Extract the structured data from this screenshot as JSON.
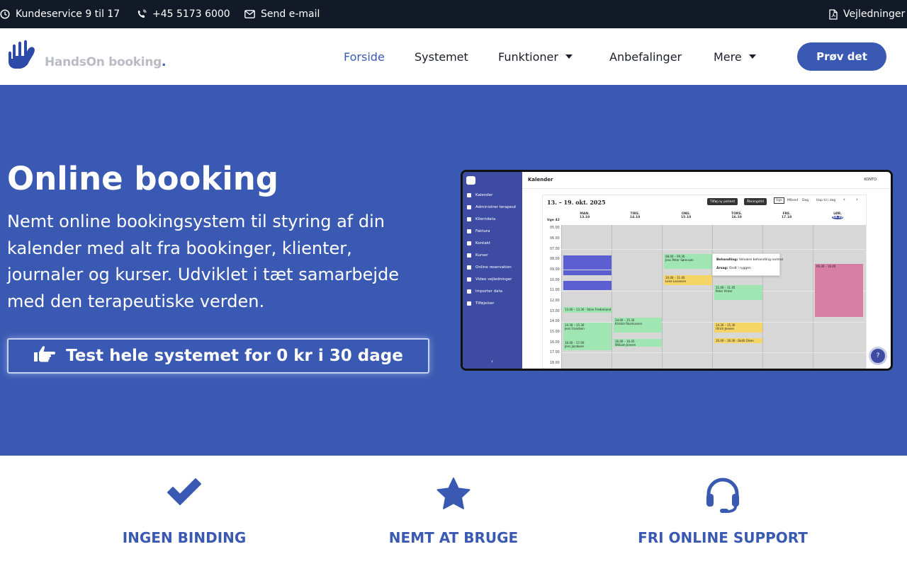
{
  "topbar": {
    "hours": "Kundeservice 9 til 17",
    "phone": "+45 5173 6000",
    "email": "Send e-mail",
    "guides": "Vejledninger"
  },
  "brand": {
    "name": "HandsOn booking",
    "dot": "."
  },
  "nav": {
    "items": [
      {
        "label": "Forside",
        "active": true
      },
      {
        "label": "Systemet"
      },
      {
        "label": "Funktioner",
        "dropdown": true
      },
      {
        "label": "Anbefalinger"
      },
      {
        "label": "Mere",
        "dropdown": true
      }
    ],
    "cta": "Prøv det"
  },
  "hero": {
    "title": "Online booking",
    "subtitle": "Nemt online bookingsystem til styring af din kalender med alt fra bookinger, klienter, journaler og kurser. Udviklet i tæt samarbejde med den terapeutiske verden.",
    "button": "Test hele systemet for 0 kr i 30 dage"
  },
  "mockup": {
    "sidebar": [
      "Kalender",
      "Administrer terapeut",
      "Klientdata",
      "Faktura",
      "Kontakt",
      "Kurser",
      "Online reservation",
      "Video vejledninger",
      "Importer data",
      "Tilføjelser"
    ],
    "title": "Kalender",
    "account": "KONTO",
    "date_range": "13. – 19. okt. 2025",
    "buttons": [
      "Tilføj ny patient",
      "Åbningstid"
    ],
    "views": [
      "Uge",
      "Måned",
      "Dag",
      "Hop til i dag"
    ],
    "week_label": "Uge 42",
    "days": [
      "MAN.",
      "TIRS.",
      "ONS.",
      "TORS.",
      "FRE.",
      "LØR."
    ],
    "dates": [
      "13.10",
      "14.10",
      "15.10",
      "16.10",
      "17.10",
      "18.10"
    ],
    "hours": [
      "05.00",
      "06.00",
      "07.00",
      "08.00",
      "09.00",
      "10.00",
      "11.00",
      "12.00",
      "13.00",
      "14.00",
      "15.00",
      "16.00",
      "17.00",
      "18.00"
    ],
    "events": {
      "e1": "08.00 – 09.30",
      "e2": "Jens Peter Sørensen",
      "e3": "10.00 – 11.00",
      "e4": "Lene Lassesen",
      "e5": "11.00 – 11.45",
      "e6": "Peter Vinter",
      "e7": "13.00 – 13.30 · Stine Fredemand",
      "e8": "14.30 – 15.30",
      "e9": "Jens Frandsen",
      "e10": "14.00 – 15.30",
      "e11": "Kirsten Rasmussen",
      "e12": "14.30 – 15.30",
      "e13": "Ulrich Jensen",
      "e14": "16.00 – 16.45",
      "e15": "William Jensen",
      "e16": "16.00 – 16.30 · Bodil Olsen",
      "e17": "16.00 – 17.00",
      "e18": "Jens Jacobsen",
      "e19": "09.30 – 16.00"
    },
    "popup": {
      "treatment_label": "Behandling:",
      "treatment": "Velvære behandling normal",
      "reason_label": "Årsag:",
      "reason": "Ondt i ryggen"
    },
    "help": "?"
  },
  "features": [
    {
      "icon": "check-icon",
      "title": "INGEN BINDING"
    },
    {
      "icon": "star-icon",
      "title": "NEMT AT BRUGE"
    },
    {
      "icon": "headset-icon",
      "title": "FRI ONLINE SUPPORT"
    }
  ],
  "colors": {
    "brand": "#3a59b2",
    "topbar": "#131a27",
    "text": "#1b1f2a"
  }
}
